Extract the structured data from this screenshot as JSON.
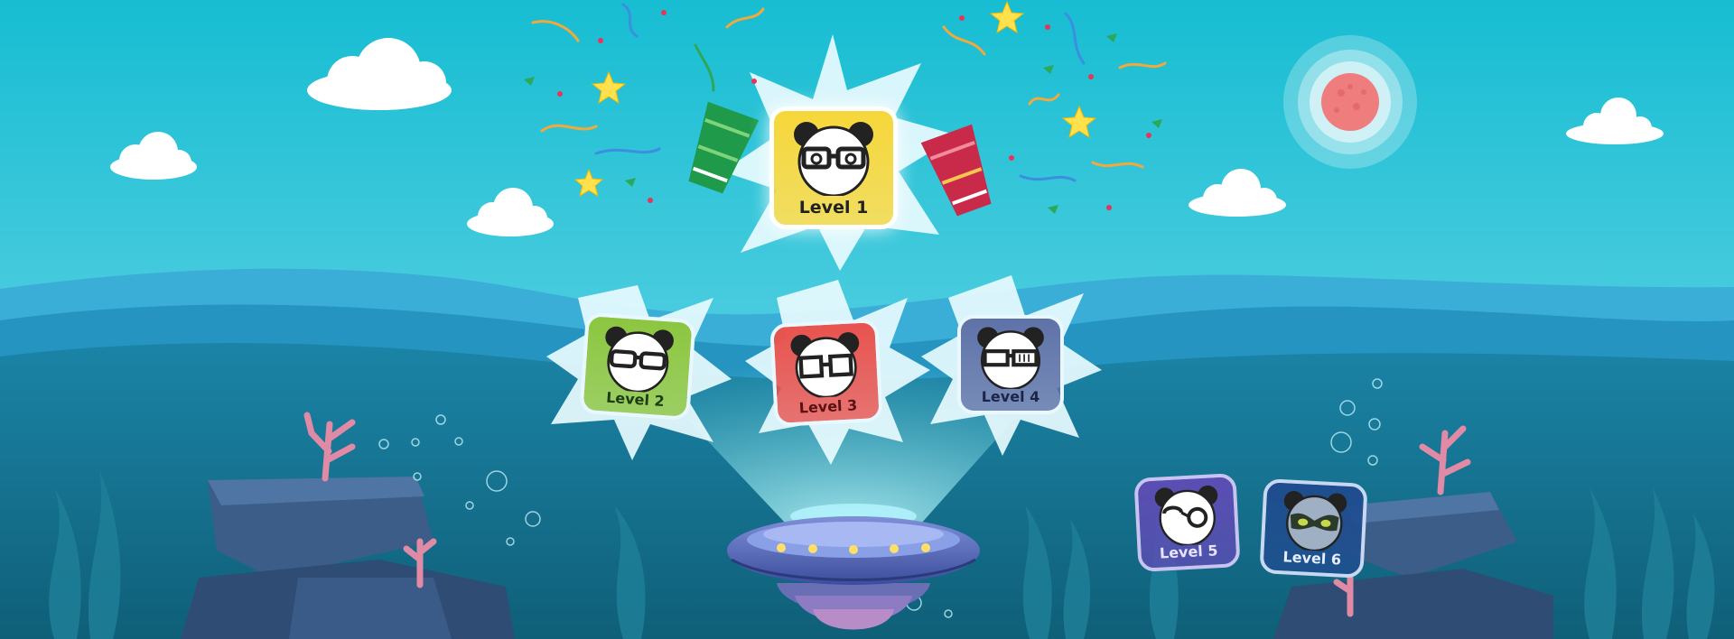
{
  "game": {
    "levels": [
      {
        "label": "Level 1",
        "color": "#f6d73a",
        "glasses": "round-glasses",
        "state": "celebrating"
      },
      {
        "label": "Level 2",
        "color": "#8cc63f",
        "glasses": "round-glasses",
        "state": "unlocked"
      },
      {
        "label": "Level 3",
        "color": "#e8534f",
        "glasses": "square-glasses",
        "state": "unlocked"
      },
      {
        "label": "Level 4",
        "color": "#5f72a8",
        "glasses": "striped-glasses",
        "state": "unlocked"
      },
      {
        "label": "Level 5",
        "color": "#5b4db3",
        "glasses": "monocle-glasses",
        "state": "underwater"
      },
      {
        "label": "Level 6",
        "color": "#1f4d8f",
        "glasses": "mask",
        "state": "underwater"
      }
    ]
  },
  "colors": {
    "sky_top": "#18bfd3",
    "sky_bottom": "#7fdcea",
    "sea_surface": "#2aa8d0",
    "sea_deep": "#13627a",
    "sun": "#f07d7d",
    "coral": "#e08aa6"
  },
  "icons": [
    "party-popper-icon",
    "confetti-icon",
    "star-icon",
    "ufo-icon",
    "cloud-icon",
    "sun-icon",
    "coral-icon",
    "panda-icon"
  ]
}
